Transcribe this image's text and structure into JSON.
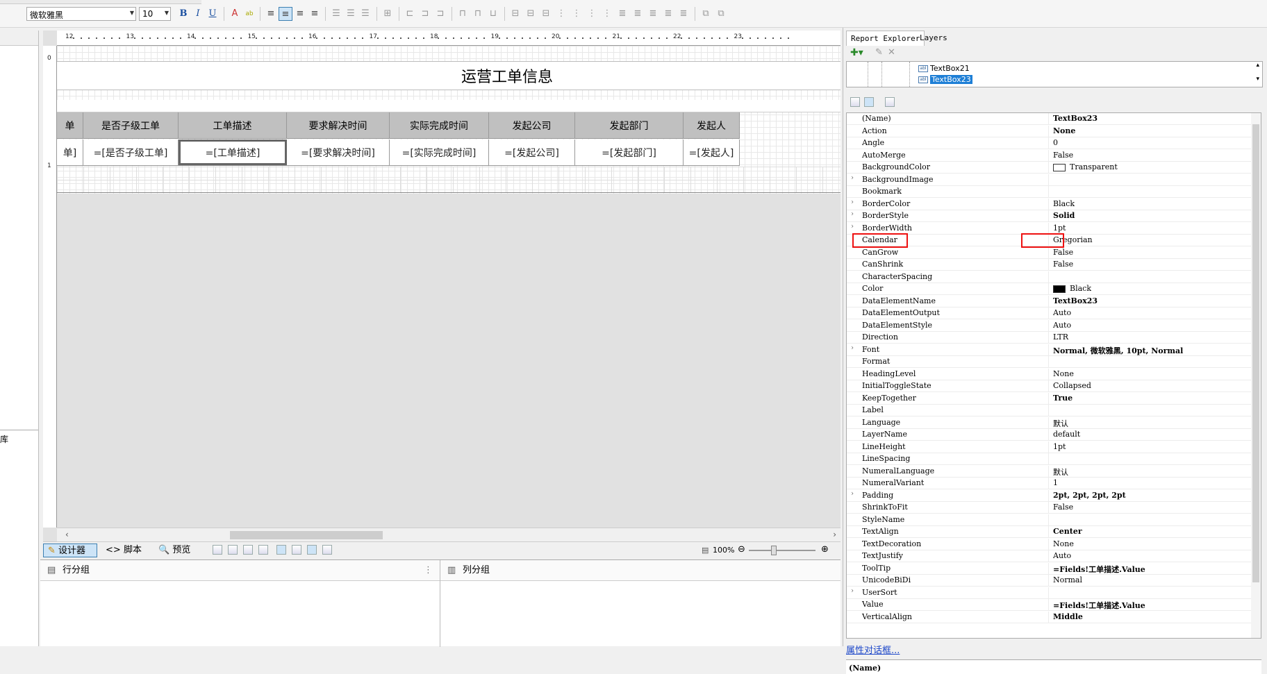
{
  "toolbar": {
    "font_name": "微软雅黑",
    "font_size": "10",
    "bold": "B",
    "italic": "I",
    "underline": "U"
  },
  "left_panel": {
    "partial_label": "库"
  },
  "ruler": {
    "h_ticks": [
      "12",
      "13",
      "14",
      "15",
      "16",
      "17",
      "18",
      "19",
      "20",
      "21",
      "22",
      "23"
    ],
    "v_ticks": [
      "0",
      "1"
    ]
  },
  "report": {
    "title": "运营工单信息",
    "columns": [
      {
        "header": "单",
        "value": "单]"
      },
      {
        "header": "是否子级工单",
        "value": "=[是否子级工单]"
      },
      {
        "header": "工单描述",
        "value": "=[工单描述]",
        "selected": true
      },
      {
        "header": "要求解决时间",
        "value": "=[要求解决时间]"
      },
      {
        "header": "实际完成时间",
        "value": "=[实际完成时间]"
      },
      {
        "header": "发起公司",
        "value": "=[发起公司]"
      },
      {
        "header": "发起部门",
        "value": "=[发起部门]"
      },
      {
        "header": "发起人",
        "value": "=[发起人]"
      }
    ]
  },
  "designer_tabs": {
    "designer": "设计器",
    "script": "脚本",
    "preview": "预览",
    "zoom": "100%"
  },
  "groups": {
    "row_group": "行分组",
    "col_group": "列分组"
  },
  "right_panel": {
    "tab_explorer": "Report Explorer",
    "tab_layers": "Layers",
    "tree": [
      "TextBox21",
      "TextBox23"
    ],
    "props": [
      {
        "name": "(Name)",
        "value": "TextBox23",
        "bold": true
      },
      {
        "name": "Action",
        "value": "None",
        "bold": true
      },
      {
        "name": "Angle",
        "value": "0"
      },
      {
        "name": "AutoMerge",
        "value": "False"
      },
      {
        "name": "BackgroundColor",
        "value": "Transparent",
        "swatch": "#ffffff"
      },
      {
        "name": "BackgroundImage",
        "value": "",
        "exp": true
      },
      {
        "name": "Bookmark",
        "value": ""
      },
      {
        "name": "BorderColor",
        "value": "Black",
        "exp": true
      },
      {
        "name": "BorderStyle",
        "value": "Solid",
        "bold": true,
        "exp": true
      },
      {
        "name": "BorderWidth",
        "value": "1pt",
        "exp": true
      },
      {
        "name": "Calendar",
        "value": "Gregorian"
      },
      {
        "name": "CanGrow",
        "value": "False"
      },
      {
        "name": "CanShrink",
        "value": "False"
      },
      {
        "name": "CharacterSpacing",
        "value": ""
      },
      {
        "name": "Color",
        "value": "Black",
        "swatch": "#000000"
      },
      {
        "name": "DataElementName",
        "value": "TextBox23",
        "bold": true
      },
      {
        "name": "DataElementOutput",
        "value": "Auto"
      },
      {
        "name": "DataElementStyle",
        "value": "Auto"
      },
      {
        "name": "Direction",
        "value": "LTR"
      },
      {
        "name": "Font",
        "value": "Normal, 微软雅黑, 10pt, Normal",
        "bold": true,
        "exp": true
      },
      {
        "name": "Format",
        "value": ""
      },
      {
        "name": "HeadingLevel",
        "value": "None"
      },
      {
        "name": "InitialToggleState",
        "value": "Collapsed"
      },
      {
        "name": "KeepTogether",
        "value": "True",
        "bold": true
      },
      {
        "name": "Label",
        "value": ""
      },
      {
        "name": "Language",
        "value": "默认"
      },
      {
        "name": "LayerName",
        "value": "default"
      },
      {
        "name": "LineHeight",
        "value": "1pt"
      },
      {
        "name": "LineSpacing",
        "value": ""
      },
      {
        "name": "NumeralLanguage",
        "value": "默认"
      },
      {
        "name": "NumeralVariant",
        "value": "1"
      },
      {
        "name": "Padding",
        "value": "2pt, 2pt, 2pt, 2pt",
        "bold": true,
        "exp": true
      },
      {
        "name": "ShrinkToFit",
        "value": "False"
      },
      {
        "name": "StyleName",
        "value": ""
      },
      {
        "name": "TextAlign",
        "value": "Center",
        "bold": true
      },
      {
        "name": "TextDecoration",
        "value": "None"
      },
      {
        "name": "TextJustify",
        "value": "Auto"
      },
      {
        "name": "ToolTip",
        "value": "=Fields!工单描述.Value",
        "bold": true
      },
      {
        "name": "UnicodeBiDi",
        "value": "Normal"
      },
      {
        "name": "UserSort",
        "value": "",
        "exp": true
      },
      {
        "name": "Value",
        "value": "=Fields!工单描述.Value",
        "bold": true
      },
      {
        "name": "VerticalAlign",
        "value": "Middle",
        "bold": true
      }
    ],
    "prop_dialog_link": "属性对话框...",
    "desc_title": "(Name)"
  }
}
